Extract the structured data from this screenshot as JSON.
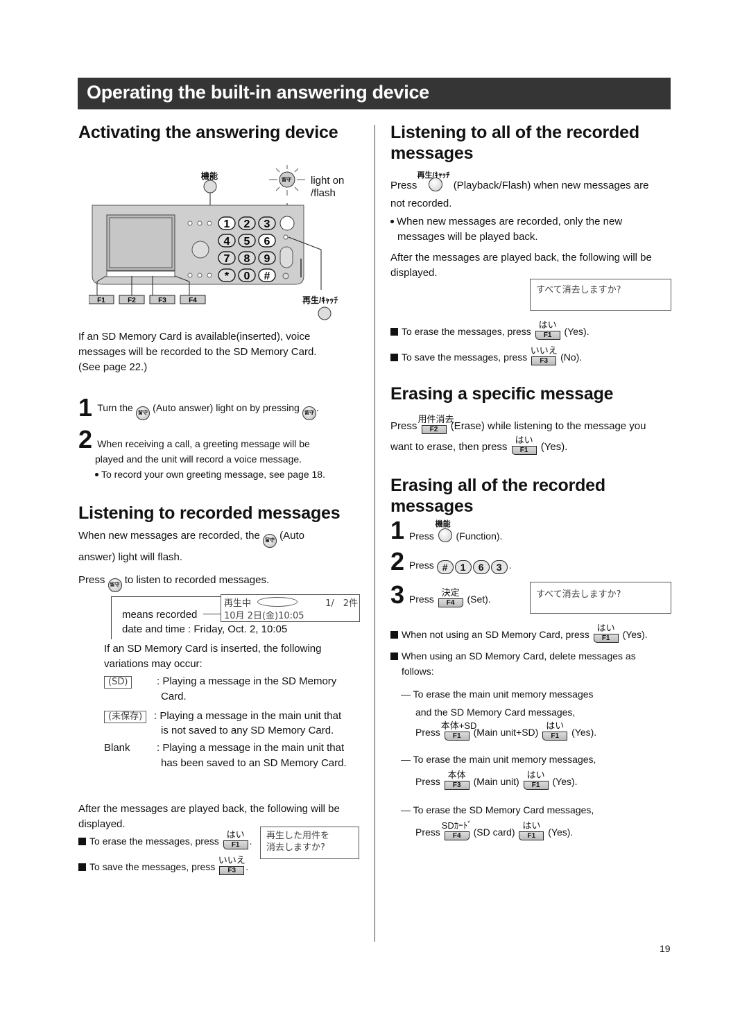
{
  "page_title": "Operating the built-in answering device",
  "page_number": "19",
  "left": {
    "activating": {
      "heading": "Activating the answering device",
      "diagram": {
        "function_label": "機能",
        "auto_answer_label": "留守",
        "light_on": "light on",
        "flash": "/flash",
        "playback_label": "再生/ｷｬｯﾁ",
        "keys": [
          "1",
          "2",
          "3",
          "4",
          "5",
          "6",
          "7",
          "8",
          "9",
          "*",
          "0",
          "#"
        ],
        "fkeys": [
          "F1",
          "F2",
          "F3",
          "F4"
        ]
      },
      "sd_note_1": "If an SD Memory Card is available(inserted), voice",
      "sd_note_2": "messages will be recorded to the SD Memory Card.",
      "sd_note_3": "(See page 22.)",
      "step1_num": "1",
      "step1_a": "Turn the",
      "step1_b": "(Auto answer) light on by pressing",
      "step1_c": ".",
      "step2_num": "2",
      "step2_a": "When receiving a call, a greeting message will be",
      "step2_b": "played and the unit will record a voice message.",
      "step2_bullet": "To record your own greeting message, see page 18."
    },
    "listening": {
      "heading": "Listening to recorded messages",
      "p1_a": "When new messages are recorded, the",
      "p1_b": "(Auto",
      "p1_c": "answer) light will flash.",
      "p2_a": "Press",
      "p2_b": "to listen to recorded messages.",
      "lcd_line1_left": "再生中",
      "lcd_line1_right": "1/　2件",
      "lcd_line2": "10月 2日(金)10:05",
      "callout_1": "means recorded",
      "callout_2": "date and time : Friday, Oct. 2, 10:05",
      "variations_intro_1": "If an SD Memory Card is inserted, the following",
      "variations_intro_2": "variations may occur:",
      "variations": [
        {
          "tag": "(SD)",
          "desc_1": ": Playing a message in the SD Memory",
          "desc_2": "Card."
        },
        {
          "tag": "(未保存)",
          "desc_1": ": Playing a message in the main unit that",
          "desc_2": "is not saved to any SD Memory Card."
        },
        {
          "tag": "Blank",
          "desc_1": ": Playing a message in the main unit that",
          "desc_2": "has been saved to an SD Memory Card."
        }
      ],
      "after_1": "After the messages are played back, the following will be",
      "after_2": "displayed.",
      "erase_text": "To erase the messages, press",
      "erase_key_label": "はい",
      "erase_key": "F1",
      "save_text": "To save the messages, press",
      "save_key_label": "いいえ",
      "save_key": "F3",
      "lcd_prompt_1": "再生した用件を",
      "lcd_prompt_2": "消去しますか?"
    }
  },
  "right": {
    "listening_all": {
      "heading_1": "Listening to all of the recorded",
      "heading_2": "messages",
      "press": "Press",
      "btn_label": "再生/ｷｬｯﾁ",
      "p1_b": "(Playback/Flash) when new messages are",
      "p1_c": "not recorded.",
      "bullet_1": "When new messages are recorded, only the new",
      "bullet_2": "messages will be played back.",
      "after_1": "After the messages are played back, the following will be",
      "after_2": "displayed.",
      "lcd": "すべて消去しますか?",
      "erase_text": "To erase the messages, press",
      "erase_key_label": "はい",
      "erase_key": "F1",
      "erase_suffix": "(Yes).",
      "save_text": "To save the messages, press",
      "save_key_label": "いいえ",
      "save_key": "F3",
      "save_suffix": "(No)."
    },
    "erase_specific": {
      "heading": "Erasing a specific message",
      "press": "Press",
      "key_label": "用件消去",
      "key": "F2",
      "p_b": "(Erase) while listening to the message you",
      "p_c": "want to erase, then press",
      "yes_label": "はい",
      "yes_key": "F1",
      "yes_suffix": "(Yes)."
    },
    "erase_all": {
      "heading_1": "Erasing all of the recorded",
      "heading_2": "messages",
      "step1_num": "1",
      "step1_press": "Press",
      "step1_label": "機能",
      "step1_suffix": "(Function).",
      "step2_num": "2",
      "step2_press": "Press",
      "step2_keys": [
        "#",
        "1",
        "6",
        "3"
      ],
      "step3_num": "3",
      "step3_press": "Press",
      "step3_label": "決定",
      "step3_key": "F4",
      "step3_suffix": "(Set).",
      "lcd": "すべて消去しますか?",
      "no_sd_text": "When not using an SD Memory Card, press",
      "no_sd_label": "はい",
      "no_sd_key": "F1",
      "no_sd_suffix": "(Yes).",
      "sd_text_1": "When using an SD Memory Card, delete messages as",
      "sd_text_2": "follows:",
      "opt1_1": "— To erase the main unit memory messages",
      "opt1_2": "and the SD Memory Card messages,",
      "opt1_press": "Press",
      "opt1_label": "本体+SD",
      "opt1_key": "F1",
      "opt1_mid": "(Main unit+SD)",
      "opt1_yes_label": "はい",
      "opt1_yes_key": "F1",
      "opt1_suffix": "(Yes).",
      "opt2_1": "— To erase the main unit memory messages,",
      "opt2_press": "Press",
      "opt2_label": "本体",
      "opt2_key": "F3",
      "opt2_mid": "(Main unit)",
      "opt2_yes_label": "はい",
      "opt2_yes_key": "F1",
      "opt2_suffix": "(Yes).",
      "opt3_1": "— To erase the SD Memory Card messages,",
      "opt3_press": "Press",
      "opt3_label": "SDｶｰﾄﾞ",
      "opt3_key": "F4",
      "opt3_mid": "(SD card)",
      "opt3_yes_label": "はい",
      "opt3_yes_key": "F1",
      "opt3_suffix": "(Yes)."
    }
  }
}
